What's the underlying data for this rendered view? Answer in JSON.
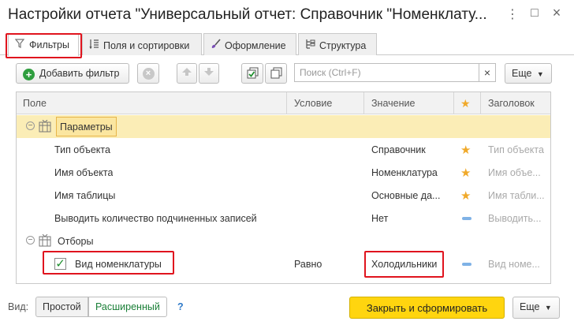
{
  "window": {
    "title": "Настройки отчета \"Универсальный отчет: Справочник \"Номенклату...",
    "more_glyph": "⋮",
    "restore_glyph": "□",
    "close_glyph": "×"
  },
  "tabs": [
    {
      "label": "Фильтры",
      "icon": "funnel-icon",
      "active": true
    },
    {
      "label": "Поля и сортировки",
      "icon": "fields-sort-icon",
      "active": false
    },
    {
      "label": "Оформление",
      "icon": "brush-icon",
      "active": false
    },
    {
      "label": "Структура",
      "icon": "structure-icon",
      "active": false
    }
  ],
  "toolbar": {
    "add_filter_label": "Добавить фильтр",
    "search_placeholder": "Поиск (Ctrl+F)",
    "search_clear": "×",
    "more_label": "Еще"
  },
  "grid": {
    "columns": [
      "Поле",
      "Условие",
      "Значение",
      "★",
      "Заголовок"
    ],
    "rows": [
      {
        "type": "group",
        "label": "Параметры",
        "selected": true
      },
      {
        "type": "item",
        "field": "Тип объекта",
        "condition": "",
        "value": "Справочник",
        "marker": "star",
        "caption": "Тип объекта"
      },
      {
        "type": "item",
        "field": "Имя объекта",
        "condition": "",
        "value": "Номенклатура",
        "marker": "star",
        "caption": "Имя объе..."
      },
      {
        "type": "item",
        "field": "Имя таблицы",
        "condition": "",
        "value": "Основные да...",
        "marker": "star",
        "caption": "Имя табли..."
      },
      {
        "type": "item",
        "field": "Выводить количество подчиненных записей",
        "condition": "",
        "value": "Нет",
        "marker": "dash",
        "caption": "Выводить..."
      },
      {
        "type": "group",
        "label": "Отборы",
        "selected": false
      },
      {
        "type": "filter",
        "field": "Вид номенклатуры",
        "checked": true,
        "condition": "Равно",
        "value": "Холодильники",
        "marker": "dash",
        "caption": "Вид номе..."
      }
    ]
  },
  "footer": {
    "view_label": "Вид:",
    "simple_label": "Простой",
    "extended_label": "Расширенный",
    "help_label": "?",
    "primary_label": "Закрыть и сформировать",
    "more_label": "Еще"
  },
  "colors": {
    "accent": "#ffd50f",
    "highlight_border": "#e0141e",
    "selected_row": "#fbedb6",
    "star": "#f0a92a"
  }
}
